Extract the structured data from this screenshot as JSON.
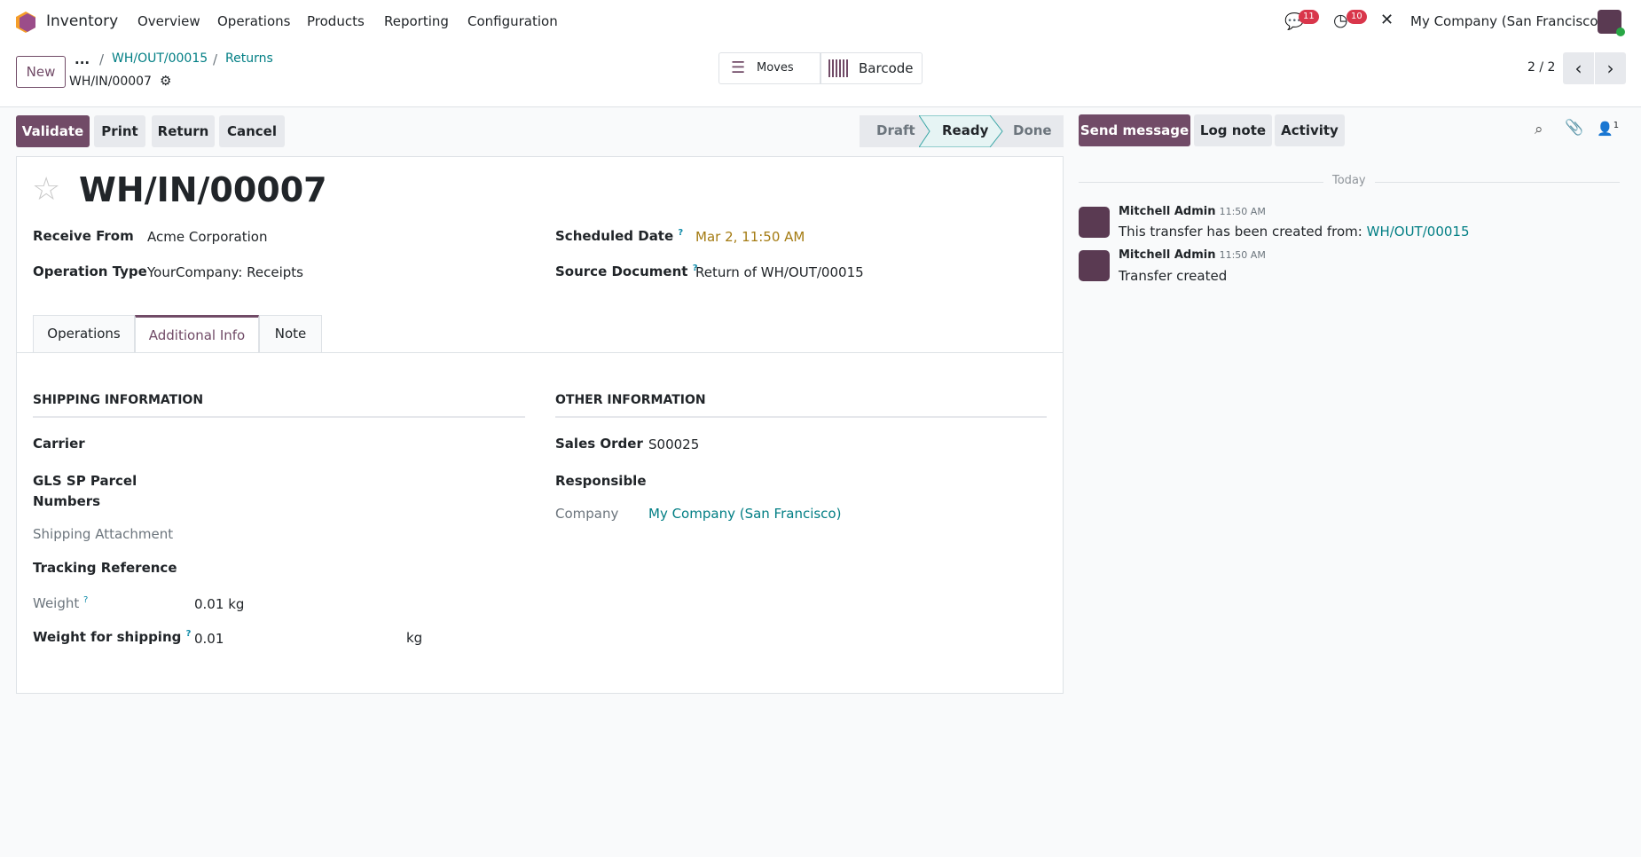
{
  "nav": {
    "app": "Inventory",
    "menu": [
      "Overview",
      "Operations",
      "Products",
      "Reporting",
      "Configuration"
    ],
    "messages_badge": "11",
    "activity_badge": "10",
    "company": "My Company (San Francisco)"
  },
  "control": {
    "new": "New",
    "ellipsis": "...",
    "breadcrumbs": [
      "WH/OUT/00015",
      "Returns"
    ],
    "current": "WH/IN/00007",
    "moves": "Moves",
    "barcode": "Barcode",
    "pager": "2 / 2"
  },
  "actions": {
    "validate": "Validate",
    "print": "Print",
    "return": "Return",
    "cancel": "Cancel"
  },
  "status": {
    "steps": [
      "Draft",
      "Ready",
      "Done"
    ],
    "active": "Ready"
  },
  "chatter_buttons": {
    "send": "Send message",
    "log": "Log note",
    "activity": "Activity",
    "followers": "1"
  },
  "form": {
    "title": "WH/IN/00007",
    "fields": {
      "receive_from_label": "Receive From",
      "receive_from": "Acme Corporation",
      "operation_type_label": "Operation Type",
      "operation_type": "YourCompany: Receipts",
      "scheduled_date_label": "Scheduled Date",
      "scheduled_date": "Mar 2, 11:50 AM",
      "source_label": "Source Document",
      "source": "Return of WH/OUT/00015",
      "help": "?"
    },
    "tabs": [
      "Operations",
      "Additional Info",
      "Note"
    ],
    "shipping": {
      "title": "SHIPPING INFORMATION",
      "carrier": "Carrier",
      "gls1": "GLS SP Parcel",
      "gls2": "Numbers",
      "attachment": "Shipping Attachment",
      "tracking": "Tracking Reference",
      "weight_label": "Weight",
      "weight": "0.01",
      "weight_uom": "kg",
      "ship_weight_label": "Weight for shipping",
      "ship_weight": "0.01",
      "ship_weight_uom": "kg"
    },
    "other": {
      "title": "OTHER INFORMATION",
      "sales_order_label": "Sales Order",
      "sales_order": "S00025",
      "responsible_label": "Responsible",
      "company_label": "Company",
      "company": "My Company (San Francisco)"
    }
  },
  "chatter": {
    "today": "Today",
    "messages": [
      {
        "author": "Mitchell Admin",
        "time": "11:50 AM",
        "text": "This transfer has been created from: ",
        "link": "WH/OUT/00015"
      },
      {
        "author": "Mitchell Admin",
        "time": "11:50 AM",
        "text": "Transfer created"
      }
    ]
  },
  "colors": {
    "primary": "#714b67",
    "link": "#017e84",
    "date": "#a47b12",
    "badge": "#d9364b"
  }
}
